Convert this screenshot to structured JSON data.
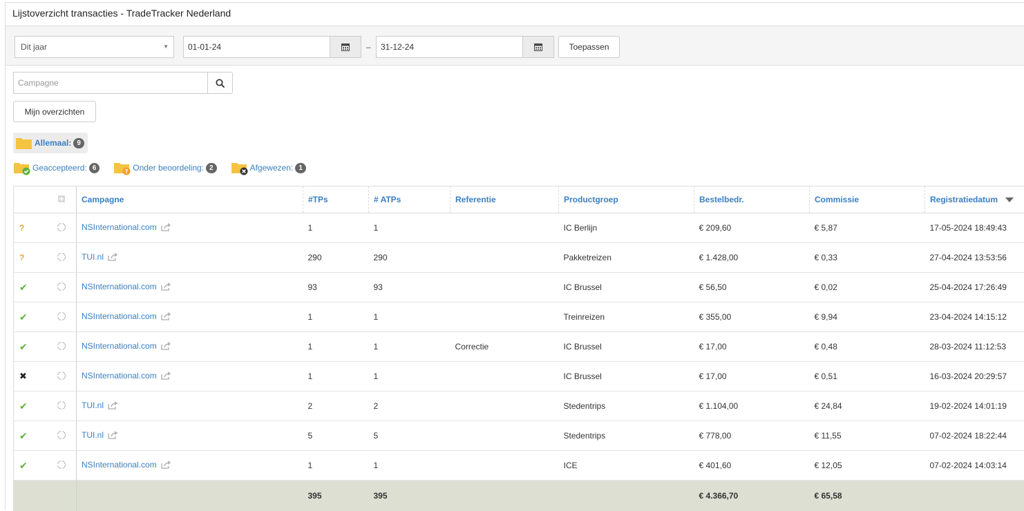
{
  "window": {
    "title": "Lijstoverzicht transacties - TradeTracker Nederland"
  },
  "filters": {
    "period_select": "Dit jaar",
    "date_from": "01-01-24",
    "date_separator": "–",
    "date_to": "31-12-24",
    "apply_label": "Toepassen"
  },
  "search": {
    "placeholder": "Campagne"
  },
  "my_overviews_label": "Mijn overzichten",
  "status_filters": {
    "all": {
      "label": "Allemaal:",
      "count": "9"
    },
    "accepted": {
      "label": "Geaccepteerd:",
      "count": "6"
    },
    "pending": {
      "label": "Onder beoordeling:",
      "count": "2"
    },
    "rejected": {
      "label": "Afgewezen:",
      "count": "1"
    }
  },
  "colors": {
    "link": "#3a7fc1",
    "accepted": "#5cb23b",
    "pending": "#f0a030",
    "total_row": "#dcdfd2",
    "folder": "#f5c342"
  },
  "table": {
    "headers": {
      "campaign": "Campagne",
      "tps": "#TPs",
      "atps": "# ATPs",
      "reference": "Referentie",
      "productgroup": "Productgroep",
      "order_amount": "Bestelbedr.",
      "commission": "Commissie",
      "registration_date": "Registratiedatum"
    },
    "sort": {
      "column": "registration_date",
      "direction": "desc"
    },
    "rows": [
      {
        "status": "pending",
        "campaign": "NSInternational.com",
        "tps": "1",
        "atps": "1",
        "reference": "",
        "productgroup": "IC Berlijn",
        "order_amount": "€ 209,60",
        "commission": "€ 5,87",
        "date": "17-05-2024 18:49:43"
      },
      {
        "status": "pending",
        "campaign": "TUI.nl",
        "tps": "290",
        "atps": "290",
        "reference": "",
        "productgroup": "Pakketreizen",
        "order_amount": "€ 1.428,00",
        "commission": "€ 0,33",
        "date": "27-04-2024 13:53:56"
      },
      {
        "status": "accepted",
        "campaign": "NSInternational.com",
        "tps": "93",
        "atps": "93",
        "reference": "",
        "productgroup": "IC Brussel",
        "order_amount": "€ 56,50",
        "commission": "€ 0,02",
        "date": "25-04-2024 17:26:49"
      },
      {
        "status": "accepted",
        "campaign": "NSInternational.com",
        "tps": "1",
        "atps": "1",
        "reference": "",
        "productgroup": "Treinreizen",
        "order_amount": "€ 355,00",
        "commission": "€ 9,94",
        "date": "23-04-2024 14:15:12"
      },
      {
        "status": "accepted",
        "campaign": "NSInternational.com",
        "tps": "1",
        "atps": "1",
        "reference": "Correctie",
        "productgroup": "IC Brussel",
        "order_amount": "€ 17,00",
        "commission": "€ 0,48",
        "date": "28-03-2024 11:12:53"
      },
      {
        "status": "rejected",
        "campaign": "NSInternational.com",
        "tps": "1",
        "atps": "1",
        "reference": "",
        "productgroup": "IC Brussel",
        "order_amount": "€ 17,00",
        "commission": "€ 0,51",
        "date": "16-03-2024 20:29:57"
      },
      {
        "status": "accepted",
        "campaign": "TUI.nl",
        "tps": "2",
        "atps": "2",
        "reference": "",
        "productgroup": "Stedentrips",
        "order_amount": "€ 1.104,00",
        "commission": "€ 24,84",
        "date": "19-02-2024 14:01:19"
      },
      {
        "status": "accepted",
        "campaign": "TUI.nl",
        "tps": "5",
        "atps": "5",
        "reference": "",
        "productgroup": "Stedentrips",
        "order_amount": "€ 778,00",
        "commission": "€ 11,55",
        "date": "07-02-2024 18:22:44"
      },
      {
        "status": "accepted",
        "campaign": "NSInternational.com",
        "tps": "1",
        "atps": "1",
        "reference": "",
        "productgroup": "ICE",
        "order_amount": "€ 401,60",
        "commission": "€ 12,05",
        "date": "07-02-2024 14:03:14"
      }
    ],
    "totals": {
      "tps": "395",
      "atps": "395",
      "order_amount": "€ 4.366,70",
      "commission": "€ 65,58"
    }
  }
}
